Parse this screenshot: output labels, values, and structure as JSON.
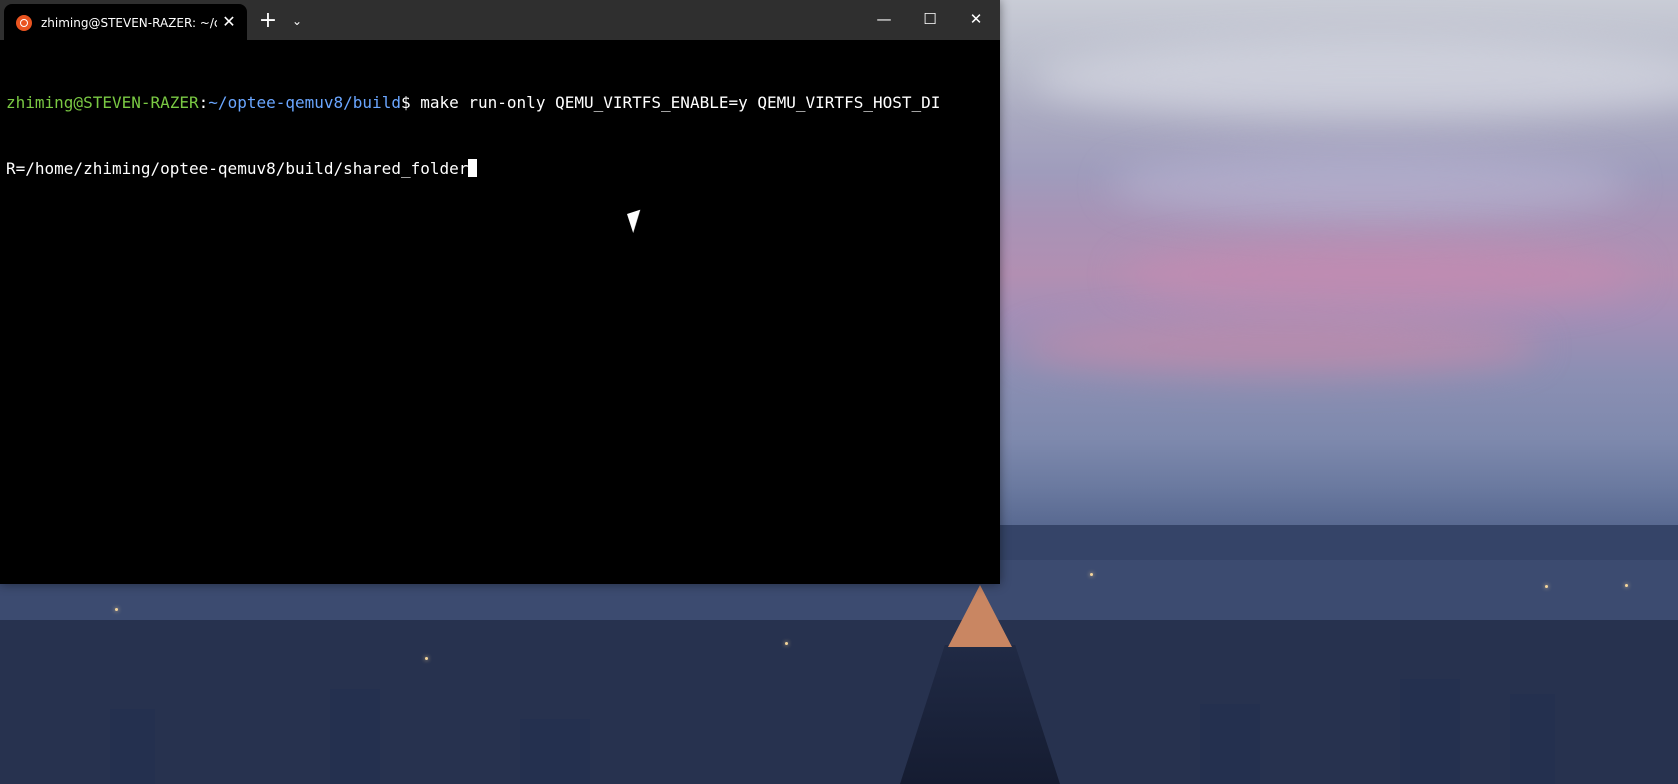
{
  "desktop": {
    "wallpaper_name": "city-skyline-dusk-wallpaper"
  },
  "terminal": {
    "tab_title": "zhiming@STEVEN-RAZER: ~/c",
    "tab_icon": "ubuntu-icon",
    "new_tab_symbol": "+",
    "dropdown_symbol": "⌄",
    "minimize_symbol": "—",
    "maximize_symbol": "☐",
    "close_symbol": "✕",
    "tab_close_symbol": "✕",
    "prompt_user": "zhiming@STEVEN-RAZER",
    "prompt_separator": ":",
    "prompt_path": "~/optee-qemuv8/build",
    "prompt_suffix": "$ ",
    "command_line_1": "make run-only QEMU_VIRTFS_ENABLE=y QEMU_VIRTFS_HOST_DI",
    "command_line_2": "R=/home/zhiming/optee-qemuv8/build/shared_folder"
  },
  "colors": {
    "terminal_background": "#000000",
    "titlebar_background": "#2f2f2f",
    "prompt_user_color": "#7ac943",
    "prompt_path_color": "#6aa6ff",
    "ubuntu_orange": "#e95420"
  }
}
